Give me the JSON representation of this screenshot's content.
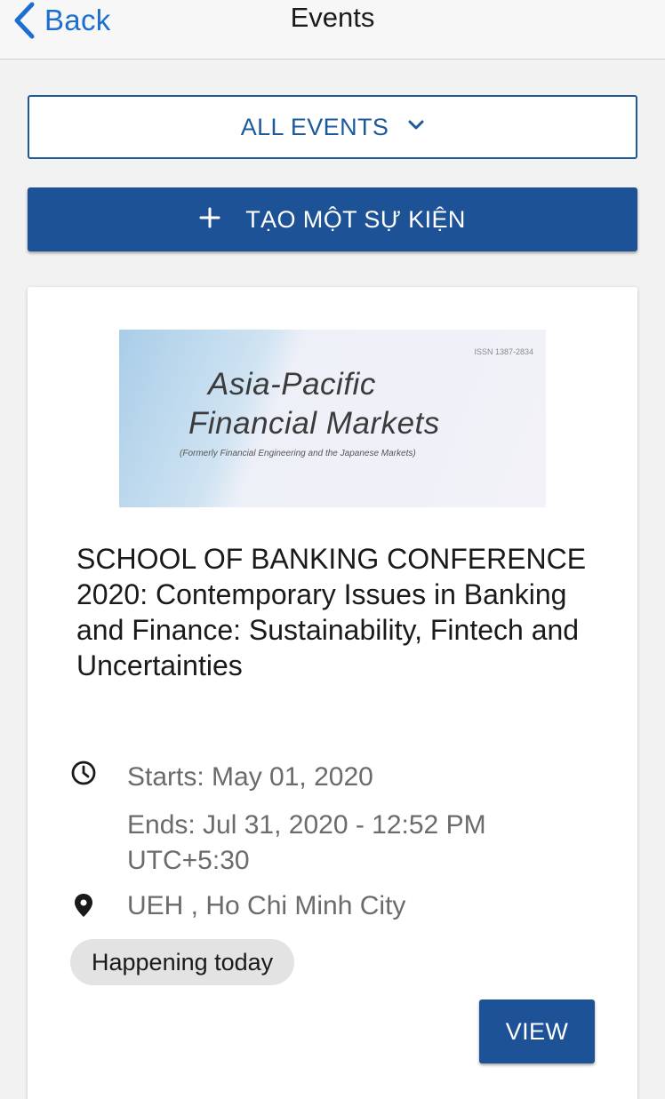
{
  "header": {
    "back_label": "Back",
    "title": "Events"
  },
  "filter": {
    "selected": "ALL EVENTS"
  },
  "create_button": {
    "label": "TẠO MỘT SỰ KIỆN"
  },
  "event": {
    "banner": {
      "issn": "ISSN 1387-2834",
      "line1": "Asia-Pacific",
      "line2": "Financial Markets",
      "subtitle": "(Formerly Financial Engineering and the Japanese Markets)"
    },
    "title": "SCHOOL OF BANKING CONFERENCE 2020: Contemporary Issues in Banking and Finance: Sustainability, Fintech and Uncertainties",
    "starts": "Starts: May 01, 2020",
    "ends": "Ends: Jul 31, 2020 - 12:52 PM",
    "timezone": "UTC+5:30",
    "location": "UEH , Ho Chi Minh City",
    "status_chip": "Happening today",
    "view_label": "VIEW"
  },
  "colors": {
    "accent": "#1d5396",
    "link": "#1c6fd1"
  },
  "icons": {
    "back": "chevron-left-icon",
    "dropdown": "chevron-down-icon",
    "create": "plus-icon",
    "time": "clock-icon",
    "location": "location-pin-icon"
  }
}
